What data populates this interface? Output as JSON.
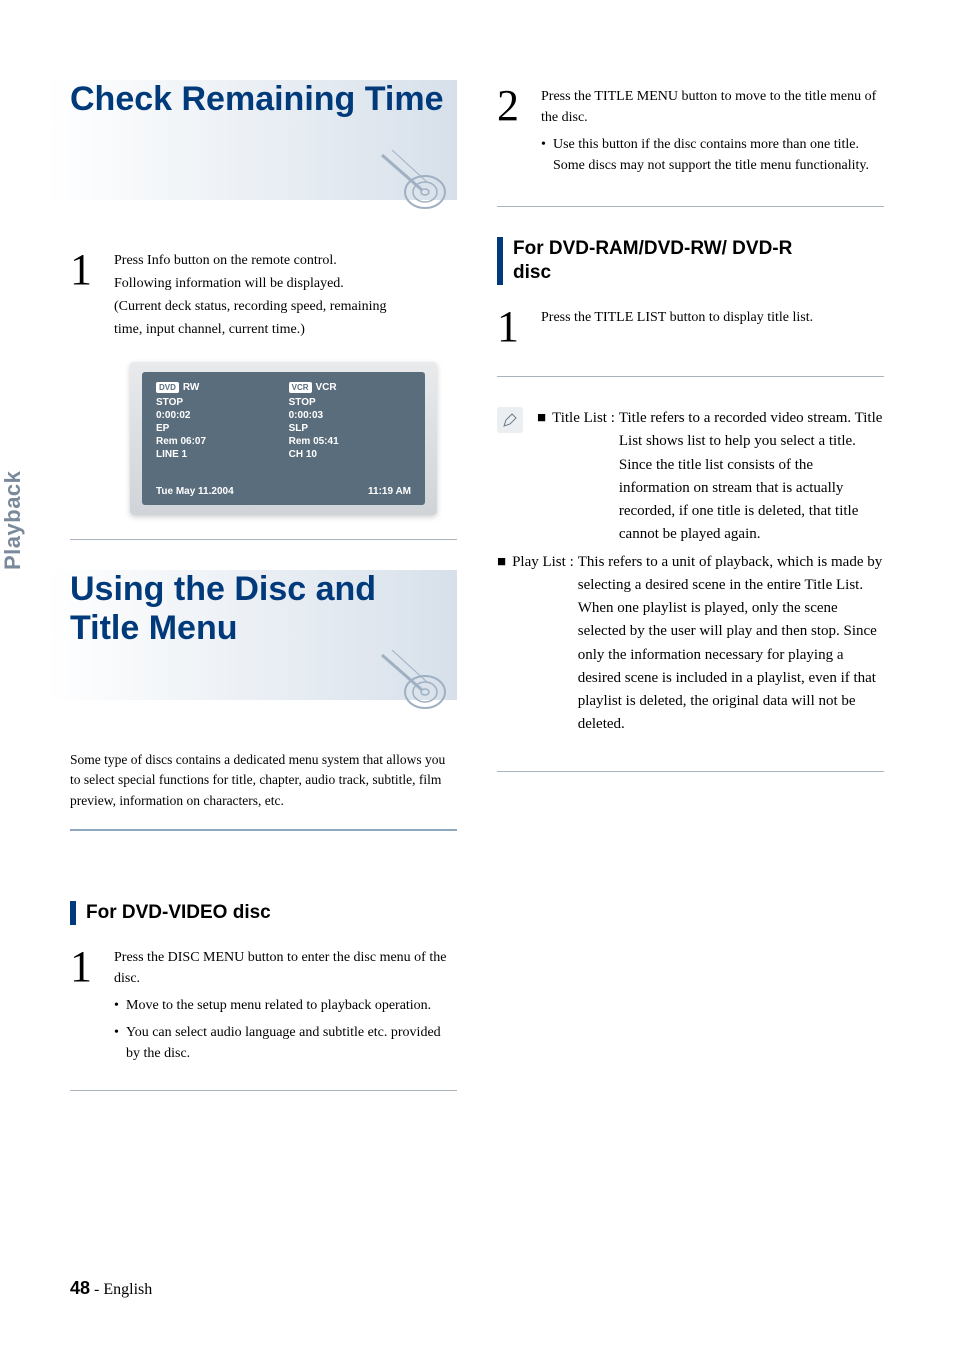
{
  "sideTab": "Playback",
  "footer": {
    "page": "48",
    "sep": " - ",
    "lang": "English"
  },
  "left": {
    "h1a": "Check Remaining Time",
    "step1": {
      "l1": "Press Info button on the remote control.",
      "l2": "Following information will be displayed.",
      "l3": "(Current deck status, recording speed, remaining",
      "l4": " time, input channel, current time.)"
    },
    "panel": {
      "left": {
        "icon": "DVD",
        "label": "RW",
        "r1": "STOP",
        "r2": "0:00:02",
        "r3": "EP",
        "r4": "Rem 06:07",
        "r5": "LINE 1"
      },
      "right": {
        "icon": "VCR",
        "label": "VCR",
        "r1": "STOP",
        "r2": "0:00:03",
        "r3": "SLP",
        "r4": "Rem 05:41",
        "r5": "CH 10"
      },
      "bottom": {
        "date": "Tue May 11.2004",
        "time": "11:19 AM"
      }
    },
    "h1b_l1": "Using the Disc and",
    "h1b_l2": "Title Menu",
    "intro": "Some type of discs contains a dedicated menu system that allows you to select special functions for title, chapter, audio track, subtitle, film preview, information on characters, etc.",
    "sub1": "For DVD-VIDEO disc",
    "dvdvideo_step1": {
      "l1": "Press the DISC MENU button to enter the disc menu of the disc.",
      "b1": "Move to the setup menu related to playback operation.",
      "b2": "You can select audio language and subtitle etc. provided by the disc."
    }
  },
  "right": {
    "step2": {
      "l1": "Press the TITLE MENU button to move to the title menu of the disc.",
      "b1": "Use this button if the disc contains more than one title. Some discs may not support the title menu functionality."
    },
    "sub2_l1": "For DVD-RAM/DVD-RW/ DVD-R",
    "sub2_l2": "disc",
    "ram_step1": "Press the TITLE LIST button to display title list.",
    "note": {
      "t_label": "Title List : ",
      "t_text": "Title refers to a recorded video stream. Title List shows list to help you select a title. Since the title list consists of the information on stream that is actually recorded, if one title is deleted, that title cannot be played again.",
      "p_label": "Play List : ",
      "p_text": "This refers to a unit of playback, which is made by selecting a desired scene in the entire Title List. When one playlist is played, only the scene selected by the user will play and then stop. Since only the information necessary for playing a desired scene is included in a playlist, even if that playlist is deleted, the original data will not be deleted."
    }
  }
}
